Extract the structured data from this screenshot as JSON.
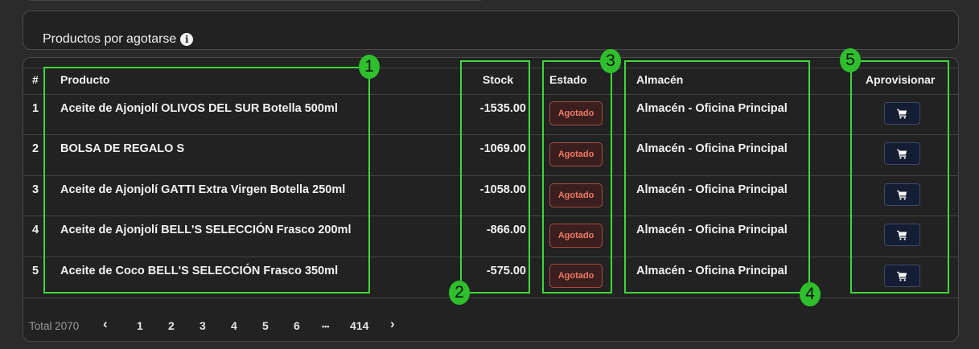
{
  "header": {
    "title": "Productos por agotarse"
  },
  "table": {
    "columns": {
      "index": "#",
      "product": "Producto",
      "stock": "Stock",
      "status": "Estado",
      "warehouse": "Almacén",
      "supply": "Aprovisionar"
    },
    "rows": [
      {
        "index": "1",
        "product": "Aceite de Ajonjolí OLIVOS DEL SUR Botella 500ml",
        "stock": "-1535.00",
        "status": "Agotado",
        "warehouse": "Almacén - Oficina Principal"
      },
      {
        "index": "2",
        "product": "BOLSA DE REGALO S",
        "stock": "-1069.00",
        "status": "Agotado",
        "warehouse": "Almacén - Oficina Principal"
      },
      {
        "index": "3",
        "product": "Aceite de Ajonjolí GATTI Extra Virgen Botella 250ml",
        "stock": "-1058.00",
        "status": "Agotado",
        "warehouse": "Almacén - Oficina Principal"
      },
      {
        "index": "4",
        "product": "Aceite de Ajonjolí BELL'S SELECCIÓN Frasco 200ml",
        "stock": "-866.00",
        "status": "Agotado",
        "warehouse": "Almacén - Oficina Principal"
      },
      {
        "index": "5",
        "product": "Aceite de Coco BELL'S SELECCIÓN Frasco 350ml",
        "stock": "-575.00",
        "status": "Agotado",
        "warehouse": "Almacén - Oficina Principal"
      }
    ]
  },
  "pagination": {
    "total": "Total 2070",
    "prev": "‹",
    "pages": [
      "1",
      "2",
      "3",
      "4",
      "5",
      "6"
    ],
    "ellipsis": "•••",
    "last": "414",
    "next": "›"
  },
  "annotations": [
    "1",
    "2",
    "3",
    "4",
    "5"
  ],
  "colors": {
    "annotation": "#3fd73a",
    "badge_text": "#f07a64",
    "background": "#222222"
  },
  "icons": {
    "info": "info-icon",
    "cart": "cart-icon"
  }
}
